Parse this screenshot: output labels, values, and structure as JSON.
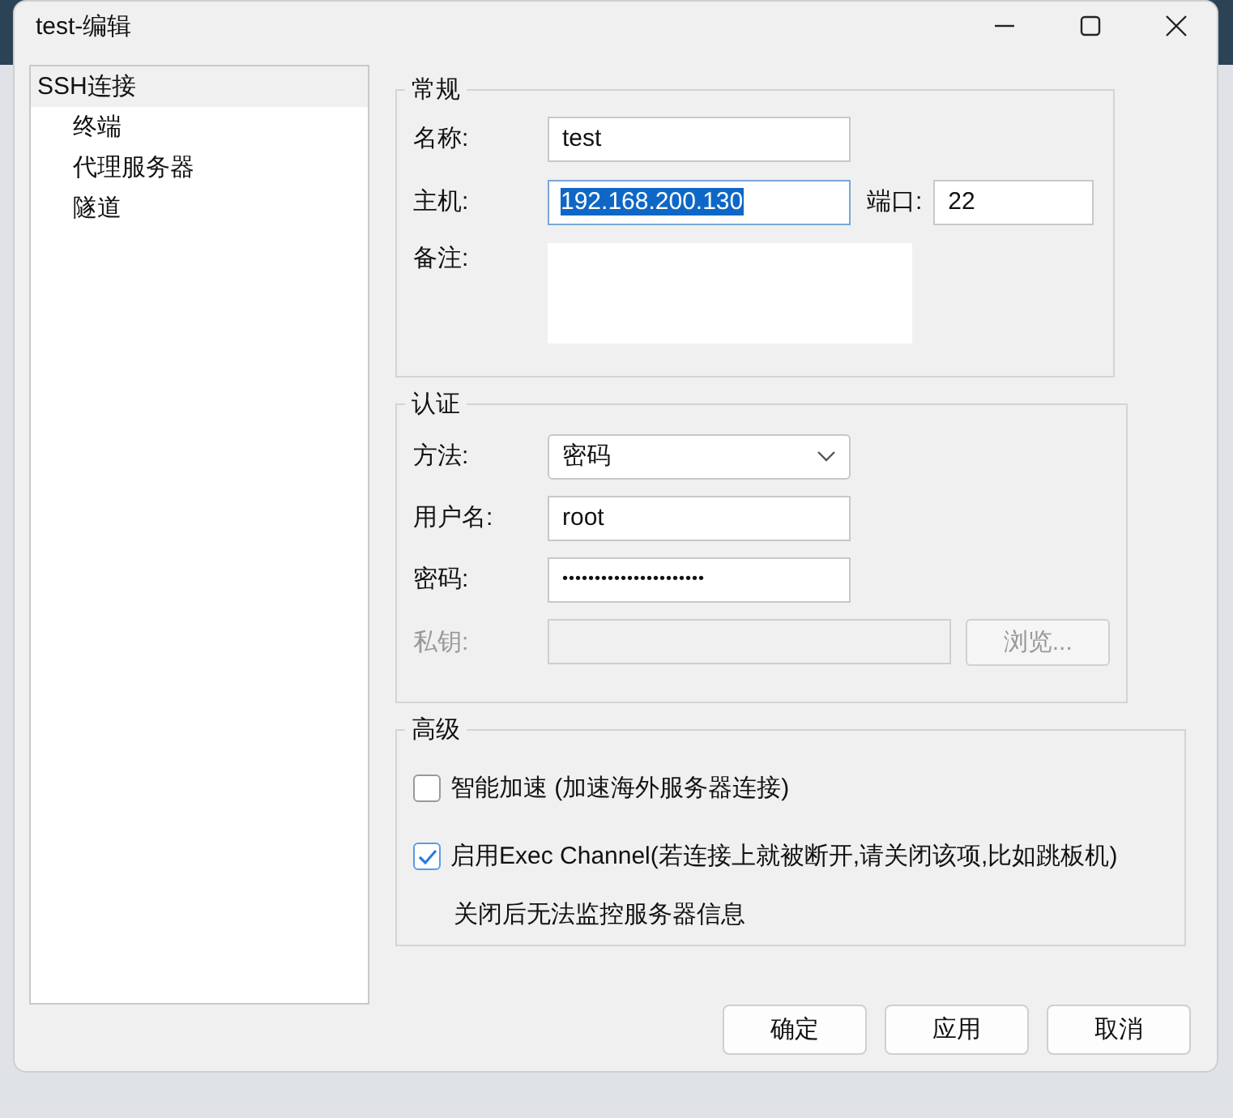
{
  "window": {
    "title": "test-编辑"
  },
  "sidebar": {
    "items": [
      {
        "label": "SSH连接",
        "selected": true,
        "children": [
          {
            "label": "终端",
            "selected": false
          },
          {
            "label": "代理服务器",
            "selected": false
          },
          {
            "label": "隧道",
            "selected": false
          }
        ]
      }
    ]
  },
  "general": {
    "title": "常规",
    "name_label": "名称:",
    "name_value": "test",
    "host_label": "主机:",
    "host_value": "192.168.200.130",
    "host_text_selected": true,
    "port_label": "端口:",
    "port_value": "22",
    "note_label": "备注:"
  },
  "auth": {
    "title": "认证",
    "method_label": "方法:",
    "method_value": "密码",
    "user_label": "用户名:",
    "user_value": "root",
    "password_label": "密码:",
    "password_value": "••••••••••••••••••••••",
    "key_label": "私钥:",
    "key_disabled": true,
    "browse_button": "浏览..."
  },
  "advanced": {
    "title": "高级",
    "options": [
      {
        "label": "智能加速 (加速海外服务器连接)",
        "checked": false
      },
      {
        "label": "启用Exec Channel(若连接上就被断开,请关闭该项,比如跳板机)",
        "checked": true
      }
    ],
    "note": "关闭后无法监控服务器信息"
  },
  "buttons": [
    "确定",
    "应用",
    "取消"
  ]
}
